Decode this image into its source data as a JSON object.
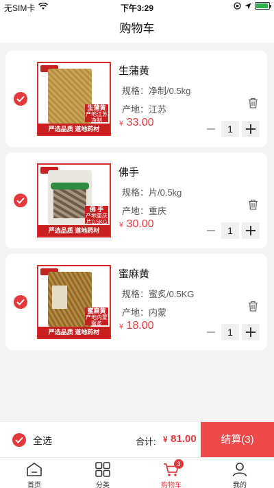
{
  "status_bar": {
    "carrier": "无SIM卡",
    "time": "下午3:29"
  },
  "header": {
    "title": "购物车"
  },
  "cart": {
    "items": [
      {
        "name": "生蒲黄",
        "spec": "规格：净制/0.5kg",
        "origin": "产地：江苏",
        "currency": "¥",
        "price": "33.00",
        "quantity": "1",
        "tag_name": "生蒲黄",
        "tag_origin": "产地江苏",
        "tag_spec": "净制0.5KG",
        "banner": "严选品质  道地药材"
      },
      {
        "name": "佛手",
        "spec": "规格：片/0.5kg",
        "origin": "产地：重庆",
        "currency": "¥",
        "price": "30.00",
        "quantity": "1",
        "tag_name": "佛 手",
        "tag_origin": "产地重庆",
        "tag_spec": "片0.5KG",
        "banner": "严选品质  道地药材"
      },
      {
        "name": "蜜麻黄",
        "spec": "规格：蜜炙/0.5KG",
        "origin": "产地：内蒙",
        "currency": "¥",
        "price": "18.00",
        "quantity": "1",
        "tag_name": "蜜麻黄",
        "tag_origin": "产地内蒙",
        "tag_spec": "蜜炙0.5KG",
        "banner": "严选品质  道地药材"
      }
    ]
  },
  "checkout": {
    "select_all": "全选",
    "total_label": "合计:",
    "currency": "¥",
    "total": "81.00",
    "button": "结算(3)"
  },
  "tabbar": {
    "items": [
      {
        "label": "首页",
        "icon": "home-icon"
      },
      {
        "label": "分类",
        "icon": "category-icon"
      },
      {
        "label": "购物车",
        "icon": "cart-icon",
        "badge": "3"
      },
      {
        "label": "我的",
        "icon": "profile-icon"
      }
    ]
  },
  "colors": {
    "accent": "#e4393c",
    "checkout_button": "#ee4a4a",
    "background": "#f4f4f4"
  }
}
